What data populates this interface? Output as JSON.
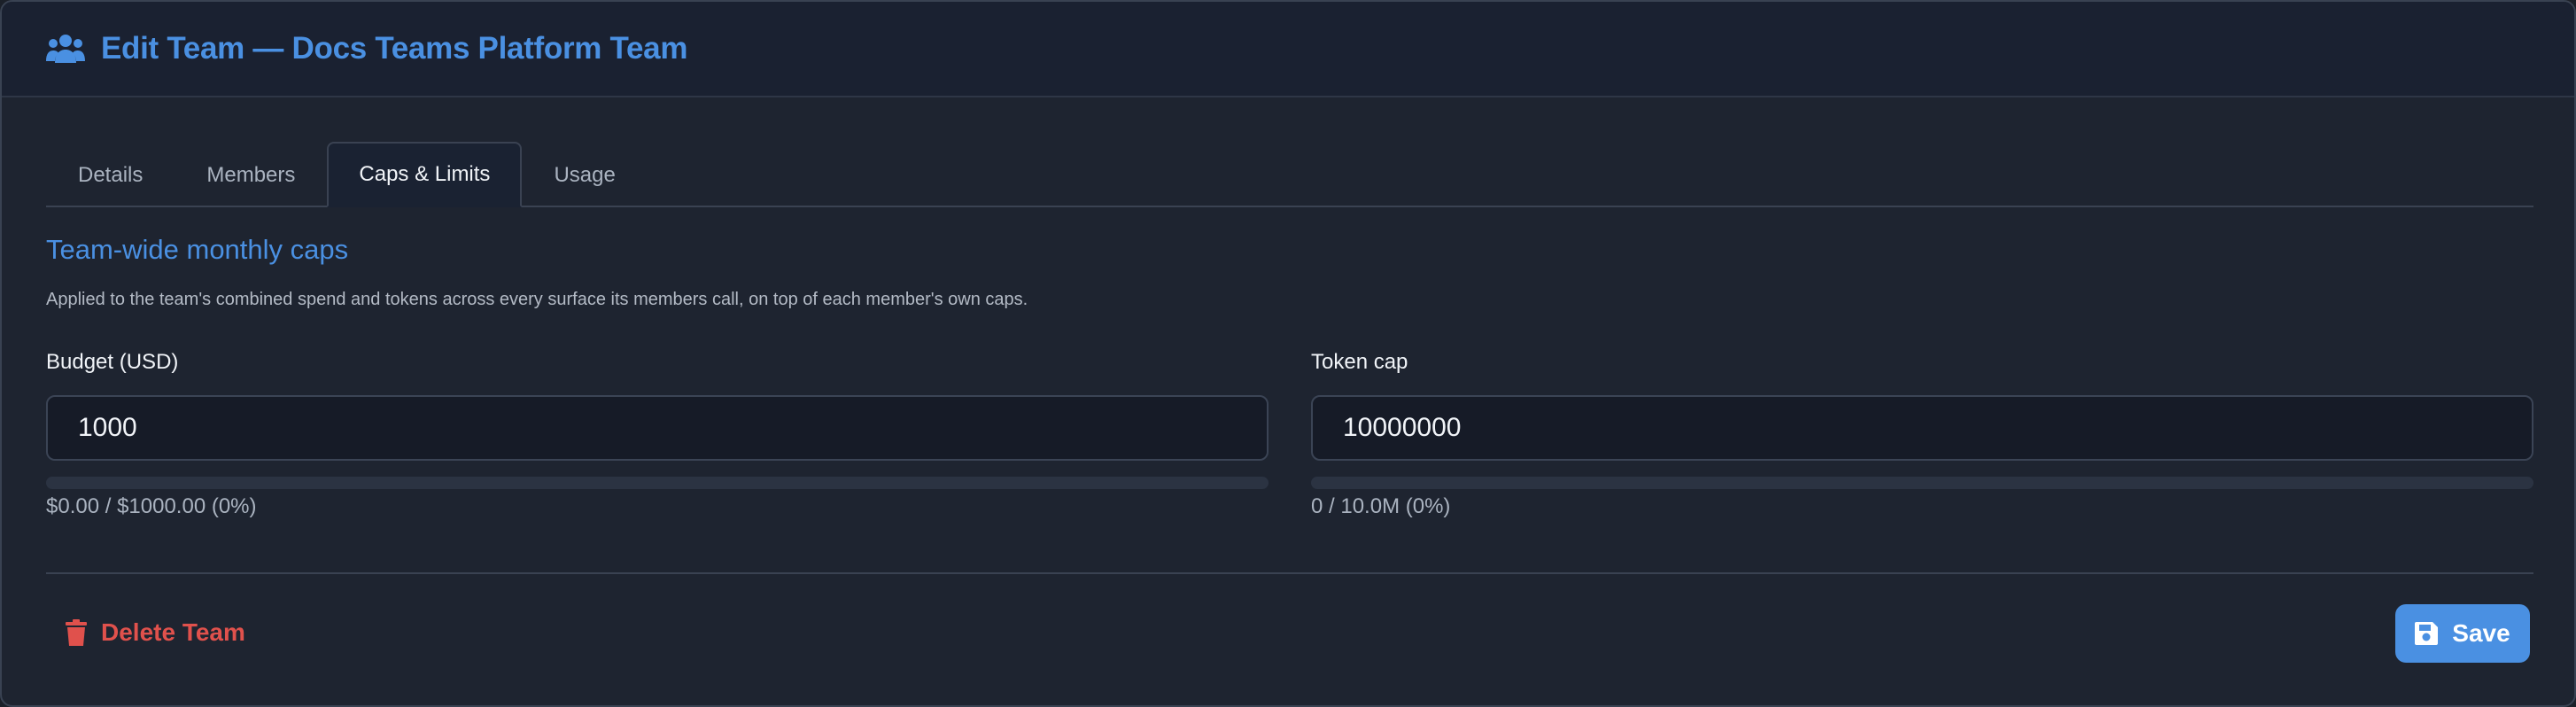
{
  "header": {
    "title": "Edit Team — Docs Teams Platform Team",
    "icon": "users-icon"
  },
  "tabs": [
    {
      "label": "Details",
      "active": false
    },
    {
      "label": "Members",
      "active": false
    },
    {
      "label": "Caps & Limits",
      "active": true
    },
    {
      "label": "Usage",
      "active": false
    }
  ],
  "section": {
    "title": "Team-wide monthly caps",
    "description": "Applied to the team's combined spend and tokens across every surface its members call, on top of each member's own caps."
  },
  "budget": {
    "label": "Budget (USD)",
    "value": "1000",
    "usage_text": "$0.00 / $1000.00 (0%)",
    "usage_fraction": 0
  },
  "tokens": {
    "label": "Token cap",
    "value": "10000000",
    "usage_text": "0 / 10.0M (0%)",
    "usage_fraction": 0
  },
  "footer": {
    "delete_label": "Delete Team",
    "save_label": "Save"
  },
  "colors": {
    "accent": "#4a90e2",
    "danger": "#e0514c",
    "background": "#1e2430"
  }
}
